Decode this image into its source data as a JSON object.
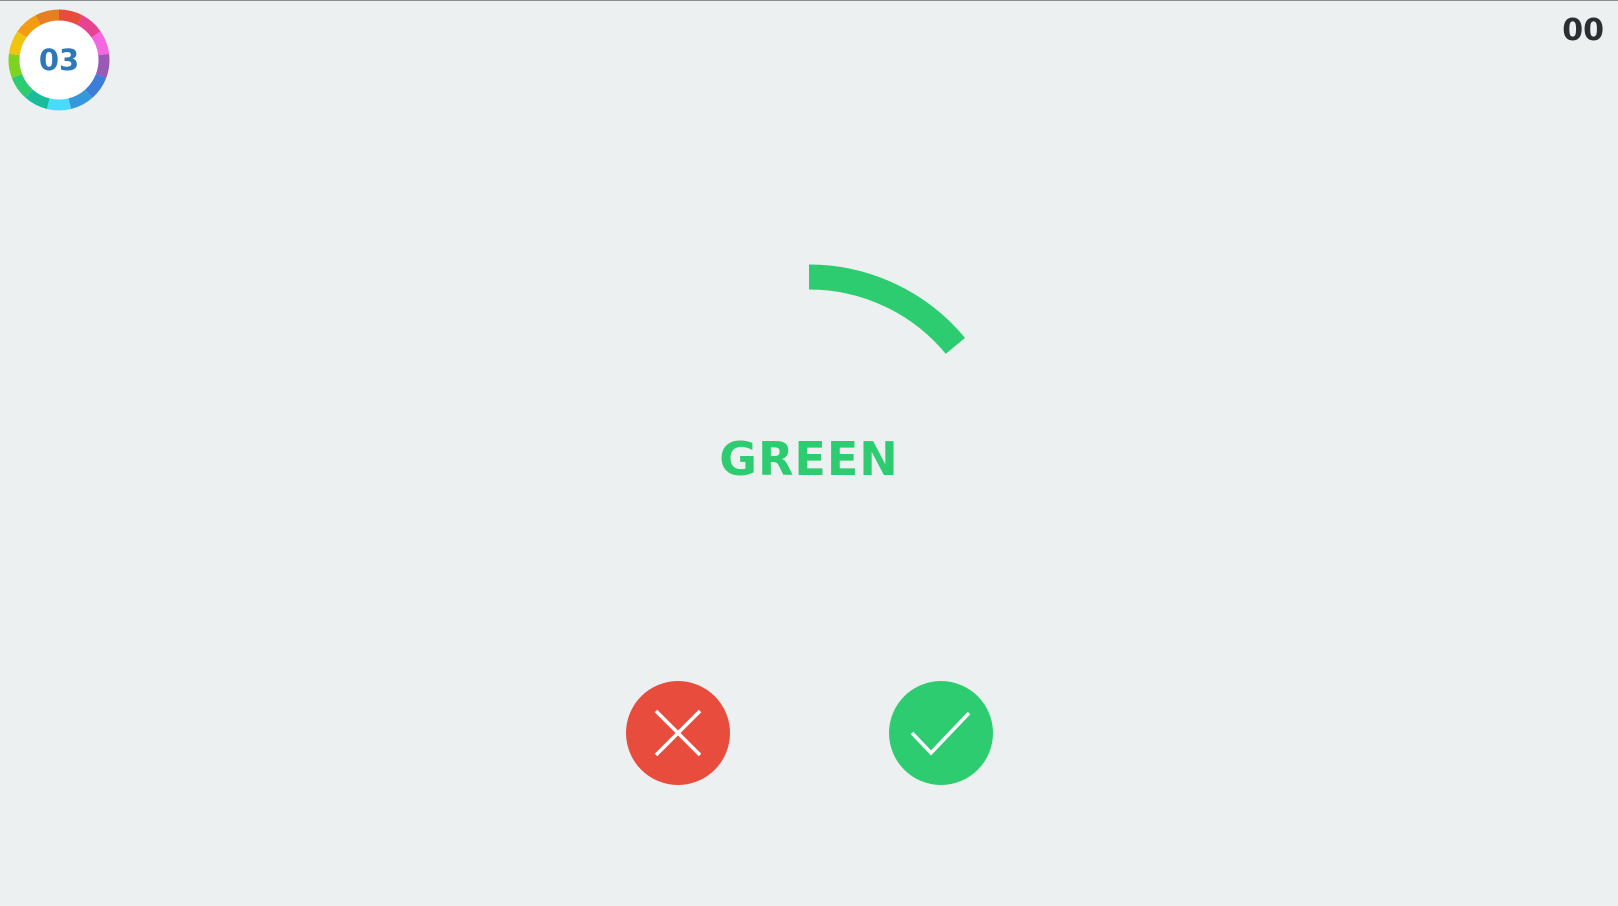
{
  "level": {
    "number": "03",
    "ring_colors": [
      "#e74c3c",
      "#e84393",
      "#f368e0",
      "#9b59b6",
      "#3b7dd8",
      "#3498db",
      "#48dbfb",
      "#1abc9c",
      "#2ecc71",
      "#7ed321",
      "#f1c40f",
      "#f39c12",
      "#e67e22"
    ]
  },
  "score": "00",
  "prompt": {
    "word": "GREEN",
    "word_color": "#2ecc71"
  },
  "timer": {
    "color": "#2ecc71",
    "remaining_fraction": 0.14
  },
  "buttons": {
    "no": {
      "icon": "cross-icon",
      "color": "#e74c3c"
    },
    "yes": {
      "icon": "check-icon",
      "color": "#2ecc71"
    }
  },
  "colors": {
    "background": "#ecf0f1",
    "level_text": "#2f78b7",
    "score_text": "#2b2f31"
  }
}
